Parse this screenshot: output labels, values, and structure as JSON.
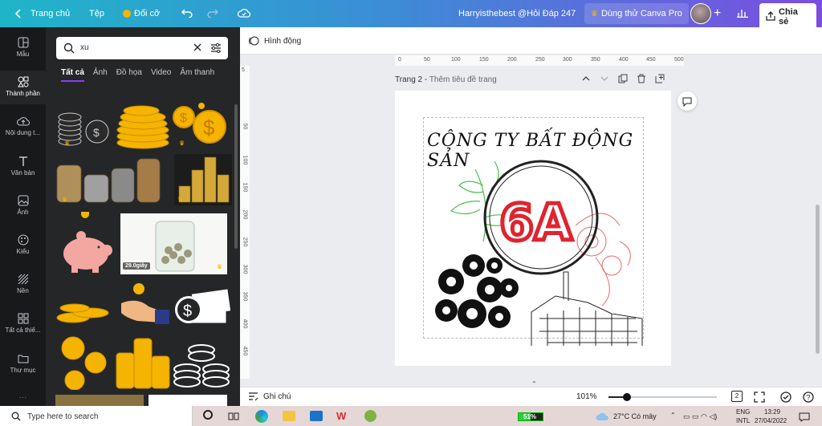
{
  "topbar": {
    "home_label": "Trang chủ",
    "file_label": "Tệp",
    "resize_label": "Đổi cỡ",
    "title": "Harryisthebest @Hỏi Đáp 247",
    "pro_label": "Dùng thử Canva Pro",
    "share_label": "Chia sẻ"
  },
  "rail": {
    "items": [
      {
        "label": "Mẫu",
        "icon": "layout-icon"
      },
      {
        "label": "Thành phần",
        "icon": "shapes-icon"
      },
      {
        "label": "Nội dung t...",
        "icon": "upload-icon"
      },
      {
        "label": "Văn bản",
        "icon": "text-icon"
      },
      {
        "label": "Ảnh",
        "icon": "image-icon"
      },
      {
        "label": "Kiểu",
        "icon": "palette-icon"
      },
      {
        "label": "Nền",
        "icon": "background-icon"
      },
      {
        "label": "Tất cả thiế...",
        "icon": "grid-icon"
      },
      {
        "label": "Thư mục",
        "icon": "folder-icon"
      }
    ]
  },
  "panel": {
    "search_value": "xu",
    "tabs": [
      "Tất cả",
      "Ảnh",
      "Đồ họa",
      "Video",
      "Âm thanh"
    ],
    "video_duration": "29.0giây"
  },
  "editor": {
    "animate_label": "Hình động",
    "page_label": "Trang 2 - ",
    "page_title_placeholder": "Thêm tiêu đề trang",
    "ruler_h": [
      "0",
      "50",
      "100",
      "150",
      "200",
      "250",
      "300",
      "350",
      "400",
      "450",
      "500"
    ],
    "ruler_v": [
      "5",
      "50",
      "100",
      "150",
      "200",
      "250",
      "300",
      "350",
      "400",
      "450"
    ],
    "design": {
      "heading": "CÔNG TY BẤT ĐỘNG SẢN",
      "logo_text": "6A"
    }
  },
  "bottombar": {
    "notes_label": "Ghi chú",
    "zoom": "101%",
    "zoom_fraction": 0.17,
    "page_count": "2"
  },
  "taskbar": {
    "search_placeholder": "Type here to search",
    "battery": "51%",
    "weather": "27°C  Có mây",
    "lang1": "ENG",
    "lang2": "INTL",
    "time": "13:29",
    "date": "27/04/2022"
  },
  "colors": {
    "accent": "#8b3dff",
    "logo_red": "#e0232e",
    "gold": "#f5b400"
  }
}
